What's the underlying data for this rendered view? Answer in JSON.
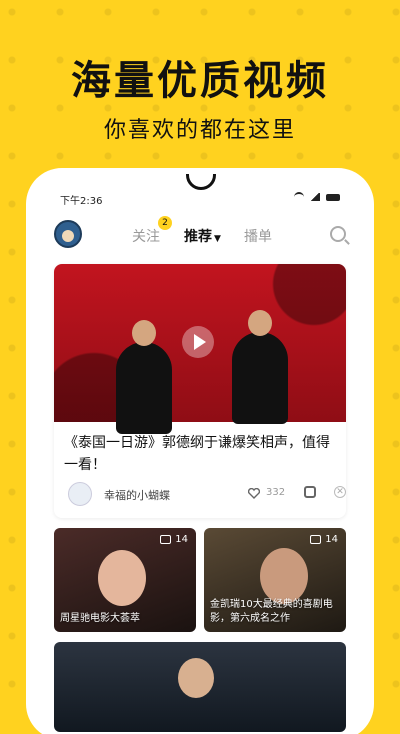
{
  "hero": {
    "headline": "海量优质视频",
    "subline": "你喜欢的都在这里"
  },
  "status": {
    "time": "下午2:36"
  },
  "nav": {
    "tabs": [
      {
        "label": "关注"
      },
      {
        "label": "推荐"
      },
      {
        "label": "播单"
      }
    ],
    "badge": "2",
    "active_index": 1
  },
  "feed": {
    "featured": {
      "title": "《泰国一日游》郭德纲于谦爆笑相声，值得一看！",
      "author": "幸福的小蝴蝶",
      "likes": "332"
    },
    "tiles": [
      {
        "count": "14",
        "title": "周星驰电影大荟萃"
      },
      {
        "count": "14",
        "title": "金凯瑞10大最经典的喜剧电影，第六成名之作"
      }
    ]
  },
  "colors": {
    "background": "#FFD21F",
    "accent": "#FFD21F",
    "thumbnail_red": "#C2141F"
  }
}
